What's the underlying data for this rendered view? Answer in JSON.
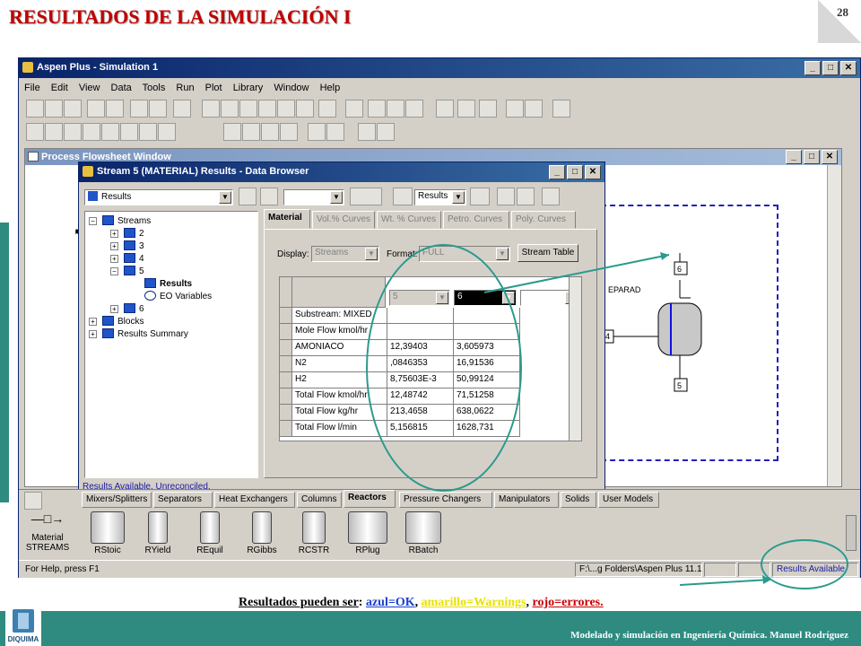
{
  "slide": {
    "title": "RESULTADOS DE LA SIMULACIÓN I",
    "page_number": "28",
    "caption_prefix": "Resultados pueden ser",
    "caption_colon": ":",
    "caption_blue": "azul=OK",
    "caption_yellow": "amarillo=Warnings",
    "caption_red": "rojo=errores.",
    "sep1": ", ",
    "sep2": ", ",
    "footer": "Modelado y simulación en Ingeniería Química.  Manuel Rodríguez",
    "logo_text": "DIQUIMA"
  },
  "app": {
    "title": "Aspen Plus - Simulation 1",
    "menu": [
      "File",
      "Edit",
      "View",
      "Data",
      "Tools",
      "Run",
      "Plot",
      "Library",
      "Window",
      "Help"
    ],
    "status_help": "For Help, press F1",
    "status_path": "F:\\...g Folders\\Aspen Plus 11.1",
    "status_results": "Results Available",
    "colors": {
      "title_bar": "#0a246a",
      "slide_accent": "#2f8b80",
      "title_red": "#c00000"
    }
  },
  "flowsheet": {
    "title": "Process Flowsheet Window",
    "block_label": "EPARAD",
    "stream_labels": [
      "6",
      "4",
      "5"
    ]
  },
  "browser": {
    "title": "Stream 5 (MATERIAL) Results - Data Browser",
    "form_select": "Results",
    "folder_select": "Results",
    "tree": [
      {
        "label": "Streams"
      },
      {
        "label": "2"
      },
      {
        "label": "3"
      },
      {
        "label": "4"
      },
      {
        "label": "5"
      },
      {
        "label": "Results"
      },
      {
        "label": "EO Variables"
      },
      {
        "label": "6"
      },
      {
        "label": "Blocks"
      },
      {
        "label": "Results Summary"
      }
    ],
    "tabs": [
      "Material",
      "Vol.% Curves",
      "Wt. % Curves",
      "Petro. Curves",
      "Poly. Curves"
    ],
    "display_label": "Display:",
    "display_value": "Streams",
    "format_label": "Format:",
    "format_value": "FULL",
    "stream_table_button": "Stream Table",
    "columns": [
      "5",
      "6",
      ""
    ],
    "rows": [
      {
        "label": "Substream: MIXED",
        "c5": "",
        "c6": ""
      },
      {
        "label": "Mole Flow kmol/hr",
        "c5": "",
        "c6": ""
      },
      {
        "label": " AMONIACO",
        "c5": "12,39403",
        "c6": "3,605973"
      },
      {
        "label": " N2",
        "c5": ",0846353",
        "c6": "16,91536"
      },
      {
        "label": " H2",
        "c5": "8,75603E-3",
        "c6": "50,99124"
      },
      {
        "label": "Total Flow kmol/hr",
        "c5": "12,48742",
        "c6": "71,51258"
      },
      {
        "label": "Total Flow kg/hr",
        "c5": "213,4658",
        "c6": "638,0622"
      },
      {
        "label": "Total Flow l/min",
        "c5": "5,156815",
        "c6": "1628,731"
      }
    ],
    "status": "Results Available. Unreconciled."
  },
  "library": {
    "tabs": [
      "Mixers/Splitters",
      "Separators",
      "Heat Exchangers",
      "Columns",
      "Reactors",
      "Pressure Changers",
      "Manipulators",
      "Solids",
      "User Models"
    ],
    "active_tab": "Reactors",
    "streams_label": "Material",
    "streams_caption": "STREAMS",
    "models": [
      "RStoic",
      "RYield",
      "REquil",
      "RGibbs",
      "RCSTR",
      "RPlug",
      "RBatch"
    ]
  }
}
